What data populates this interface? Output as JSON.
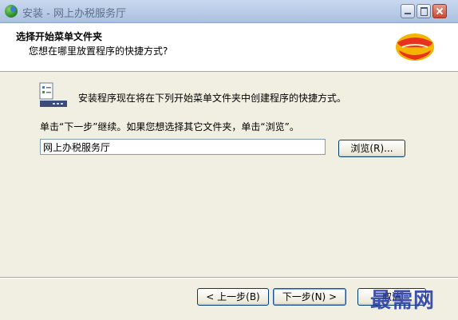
{
  "window": {
    "title": "安装 - 网上办税服务厅"
  },
  "header": {
    "title": "选择开始菜单文件夹",
    "subtitle": "您想在哪里放置程序的快捷方式?"
  },
  "body": {
    "info": "安装程序现在将在下列开始菜单文件夹中创建程序的快捷方式。",
    "hint": "单击“下一步”继续。如果您想选择其它文件夹，单击“浏览”。",
    "folder_value": "网上办税服务厅",
    "browse_label": "浏览(R)..."
  },
  "footer": {
    "back_label": "< 上一步(B)",
    "next_label": "下一步(N) >",
    "cancel_label": "取消",
    "watermark": "最需网"
  },
  "icons": {
    "app": "installer-globe-icon",
    "logo": "red-heart-logo-icon",
    "folder": "start-menu-folder-icon"
  },
  "colors": {
    "title_bar": "#b4c8e6",
    "dialog_bg": "#f1efe2",
    "button_border": "#003c74",
    "watermark": "#2a3fa8",
    "logo_red": "#e8321f",
    "logo_yellow": "#f4b400"
  }
}
